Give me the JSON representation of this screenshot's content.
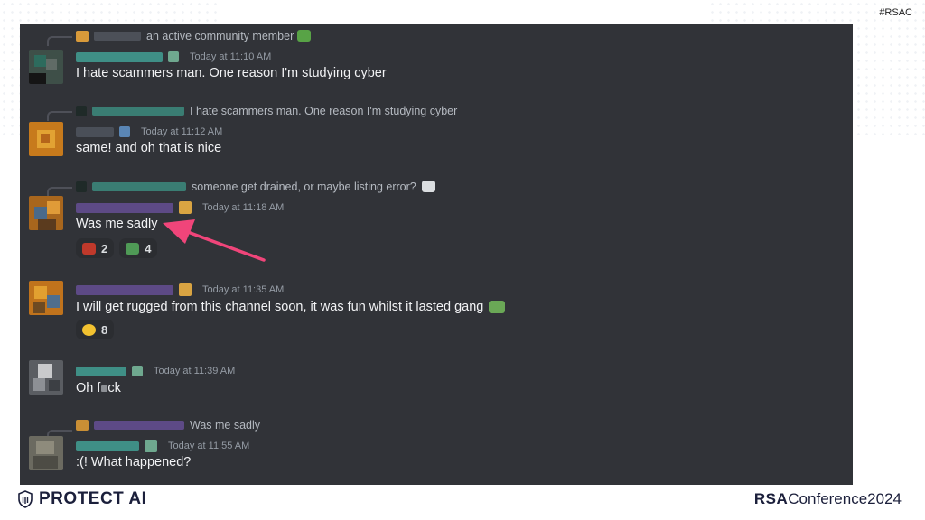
{
  "slide": {
    "hashtag": "#RSAC",
    "footer_brand": "PROTECT AI",
    "footer_conf_bold": "RSA",
    "footer_conf_light": "Conference",
    "footer_conf_year": "2024"
  },
  "messages": [
    {
      "reply_preview": "an active community member",
      "timestamp": "Today at 11:10 AM",
      "text": "I hate scammers man. One reason I'm studying cyber"
    },
    {
      "reply_preview": "I hate scammers man. One reason I'm studying cyber",
      "timestamp": "Today at 11:12 AM",
      "text": "same! and oh that is nice"
    },
    {
      "reply_preview": "someone get drained, or maybe listing error?",
      "timestamp": "Today at 11:18 AM",
      "text": "Was me sadly",
      "reactions": [
        {
          "emoji": "frog-face-emoji",
          "count": "2"
        },
        {
          "emoji": "crocodile-emoji",
          "count": "4"
        }
      ]
    },
    {
      "timestamp": "Today at 11:35 AM",
      "text": "I will get rugged from this channel soon, it was fun whilst it lasted gang",
      "reactions": [
        {
          "emoji": "crying-face-emoji",
          "count": "8"
        }
      ]
    },
    {
      "timestamp": "Today at 11:39 AM",
      "text_pre": "Oh f",
      "text_post": "ck"
    },
    {
      "reply_preview": "Was me sadly",
      "timestamp": "Today at 11:55 AM",
      "text": ":(! What happened?"
    }
  ],
  "colors": {
    "chat_background": "#313338",
    "annotation_arrow": "#f0457a",
    "redaction_green": "#3f8f86",
    "redaction_purple": "#5d4a86"
  }
}
